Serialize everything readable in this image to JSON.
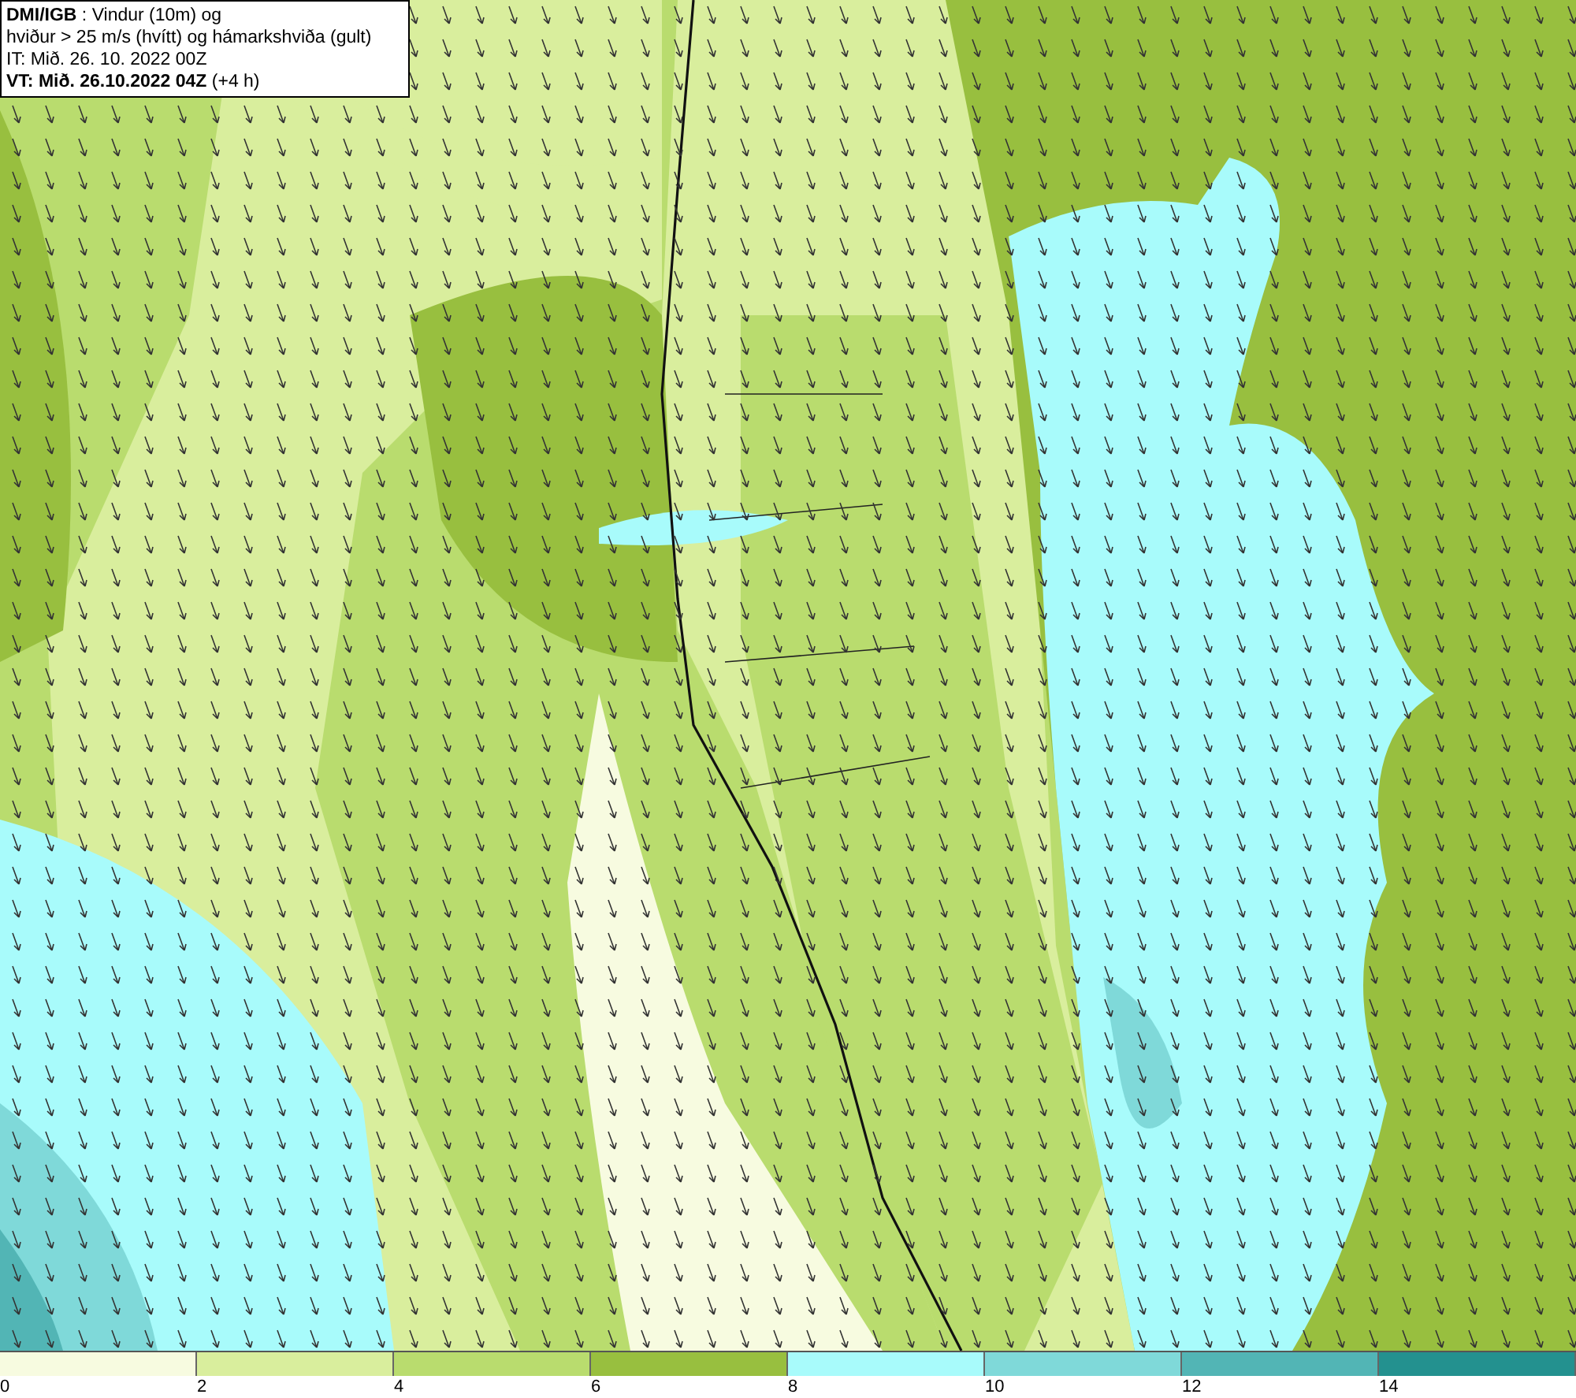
{
  "title_box": {
    "lines": [
      "**DMI/IGB** : Vindur (10m) og",
      "hviður > 25 m/s (hvítt) og hámarkshviða (gult)",
      "IT: Mið. 26. 10. 2022 00Z",
      "**VT: Mið. 26.10.2022 04Z** (+4 h)"
    ]
  },
  "legend": {
    "bins": [
      {
        "label": "0",
        "color": "#f7fbe0"
      },
      {
        "label": "2",
        "color": "#d9ee9d"
      },
      {
        "label": "4",
        "color": "#b9dc6e"
      },
      {
        "label": "6",
        "color": "#98bf3f"
      },
      {
        "label": "8",
        "color": "#a8fbfb"
      },
      {
        "label": "10",
        "color": "#7fd9d9"
      },
      {
        "label": "12",
        "color": "#52b5b5"
      },
      {
        "label": "14",
        "color": "#23918f"
      }
    ]
  }
}
